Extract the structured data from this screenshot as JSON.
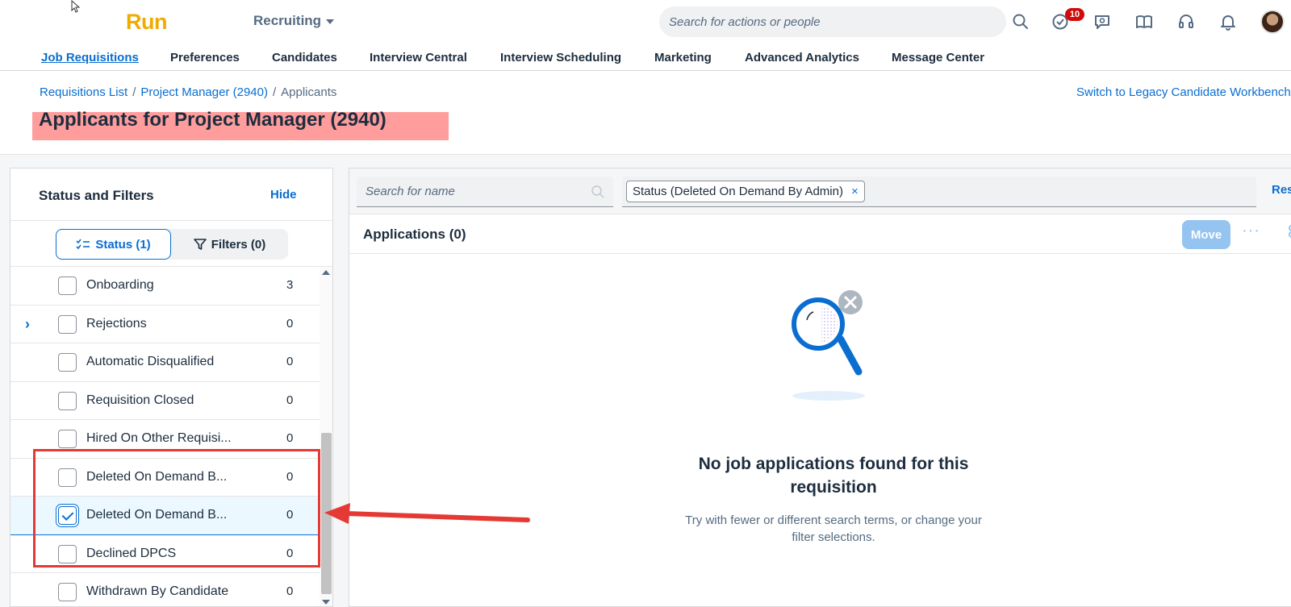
{
  "shell": {
    "logo": "Run",
    "product": "Recruiting",
    "search_placeholder": "Search for actions or people",
    "notification_count": "10"
  },
  "nav": {
    "items": [
      {
        "label": "Job Requisitions",
        "active": true
      },
      {
        "label": "Preferences"
      },
      {
        "label": "Candidates"
      },
      {
        "label": "Interview Central"
      },
      {
        "label": "Interview Scheduling"
      },
      {
        "label": "Marketing"
      },
      {
        "label": "Advanced Analytics"
      },
      {
        "label": "Message Center"
      }
    ]
  },
  "header": {
    "breadcrumb": [
      "Requisitions List",
      "Project Manager (2940)",
      "Applicants"
    ],
    "separator": "/",
    "legacy_link": "Switch to Legacy Candidate Workbench",
    "title": "Applicants for Project Manager (2940)"
  },
  "left_panel": {
    "title": "Status and Filters",
    "hide_label": "Hide",
    "status_tab": "Status (1)",
    "filters_tab": "Filters (0)",
    "statuses": [
      {
        "label": "Onboarding",
        "count": "3",
        "checked": false
      },
      {
        "label": "Rejections",
        "count": "0",
        "checked": false,
        "expandable": true
      },
      {
        "label": "Automatic Disqualified",
        "count": "0",
        "checked": false
      },
      {
        "label": "Requisition Closed",
        "count": "0",
        "checked": false
      },
      {
        "label": "Hired On Other Requisi...",
        "count": "0",
        "checked": false
      },
      {
        "label": "Deleted On Demand B...",
        "count": "0",
        "checked": false
      },
      {
        "label": "Deleted On Demand B...",
        "count": "0",
        "checked": true
      },
      {
        "label": "Declined DPCS",
        "count": "0",
        "checked": false
      },
      {
        "label": "Withdrawn By Candidate",
        "count": "0",
        "checked": false
      }
    ]
  },
  "right_panel": {
    "name_search_placeholder": "Search for name",
    "filter_token": "Status (Deleted On Demand By Admin)",
    "token_remove": "×",
    "reset_label": "Res",
    "applications_title": "Applications (0)",
    "move_label": "Move",
    "more_label": "···",
    "empty_title": "No job applications found for this requisition",
    "empty_subtitle": "Try with fewer or different search terms, or change your filter selections."
  },
  "colors": {
    "brand_link": "#0a6ed1",
    "logo": "#f0ab00",
    "annotation_red": "#e53935",
    "title_highlight": "#ff9c9c"
  }
}
